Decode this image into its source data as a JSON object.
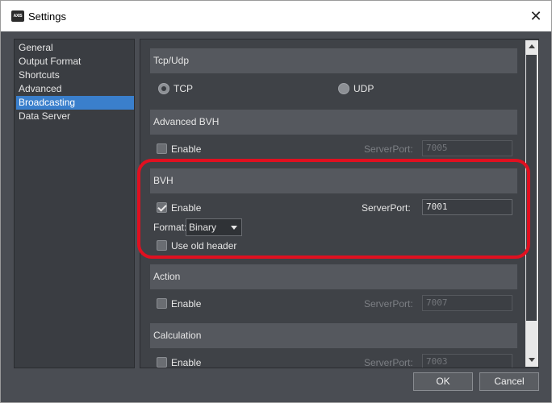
{
  "window": {
    "title": "Settings",
    "app_icon_text": "AXIS"
  },
  "nav": {
    "items": [
      {
        "label": "General"
      },
      {
        "label": "Output Format"
      },
      {
        "label": "Shortcuts"
      },
      {
        "label": "Advanced"
      },
      {
        "label": "Broadcasting",
        "selected": true
      },
      {
        "label": "Data Server"
      }
    ]
  },
  "tcp_udp": {
    "header": "Tcp/Udp",
    "tcp_label": "TCP",
    "udp_label": "UDP",
    "selected": "TCP"
  },
  "advanced_bvh": {
    "header": "Advanced BVH",
    "enable_label": "Enable",
    "enabled": false,
    "port_label": "ServerPort:",
    "port_value": "7005"
  },
  "bvh": {
    "header": "BVH",
    "enable_label": "Enable",
    "enabled": true,
    "port_label": "ServerPort:",
    "port_value": "7001",
    "format_label": "Format:",
    "format_value": "Binary",
    "old_header_label": "Use old header",
    "old_header_checked": false
  },
  "action": {
    "header": "Action",
    "enable_label": "Enable",
    "enabled": false,
    "port_label": "ServerPort:",
    "port_value": "7007"
  },
  "calculation": {
    "header": "Calculation",
    "enable_label": "Enable",
    "enabled": false,
    "port_label": "ServerPort:",
    "port_value": "7003"
  },
  "buttons": {
    "ok": "OK",
    "cancel": "Cancel"
  },
  "colors": {
    "highlight": "#e01020",
    "selection": "#3a7fcc",
    "background": "#4a4d53"
  }
}
